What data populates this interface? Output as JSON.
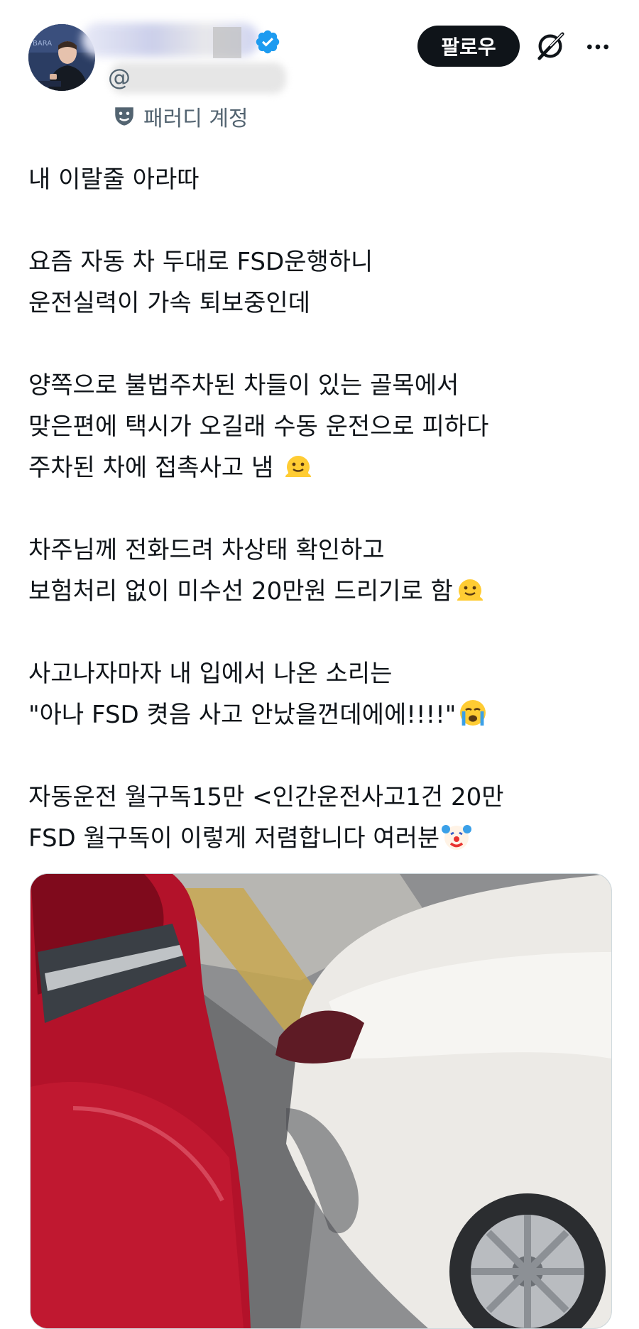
{
  "header": {
    "handle_prefix": "@",
    "parody_label": "패러디 계정",
    "follow_label": "팔로우"
  },
  "icons": {
    "verified": "verified-badge-icon",
    "parody": "parody-mask-icon",
    "grok": "grok-icon",
    "more": "more-icon"
  },
  "colors": {
    "verified_blue": "#1d9bf0",
    "follow_bg": "#0f1419",
    "secondary_text": "#536471"
  },
  "tweet": {
    "lines": [
      "내 이랄줄 아라따",
      "",
      "요즘 자동 차 두대로 FSD운행하니",
      "운전실력이 가속 퇴보중인데",
      "",
      "양쪽으로 불법주차된 차들이 있는 골목에서",
      "맞은편에 택시가 오길래 수동 운전으로 피하다",
      "주차된 차에 접촉사고 냄",
      "",
      "차주님께 전화드려 차상태 확인하고",
      "보험처리 없이 미수선 20만원 드리기로 함",
      "",
      "사고나자마자 내 입에서 나온 소리는",
      "\"아나 FSD 켯음 사고 안났을껀데에에!!!!\"",
      "",
      "자동운전 월구독15만 <인간운전사고1건 20만",
      "FSD 월구독이 이렇게 저렴합니다 여러분"
    ],
    "emojis": {
      "line_7": "melting-face-emoji",
      "line_10": "melting-face-emoji",
      "line_13": "loudly-crying-face-emoji",
      "line_16": "clown-face-emoji"
    }
  },
  "media": {
    "photo": "photo-of-red-car-and-white-car-collision"
  }
}
